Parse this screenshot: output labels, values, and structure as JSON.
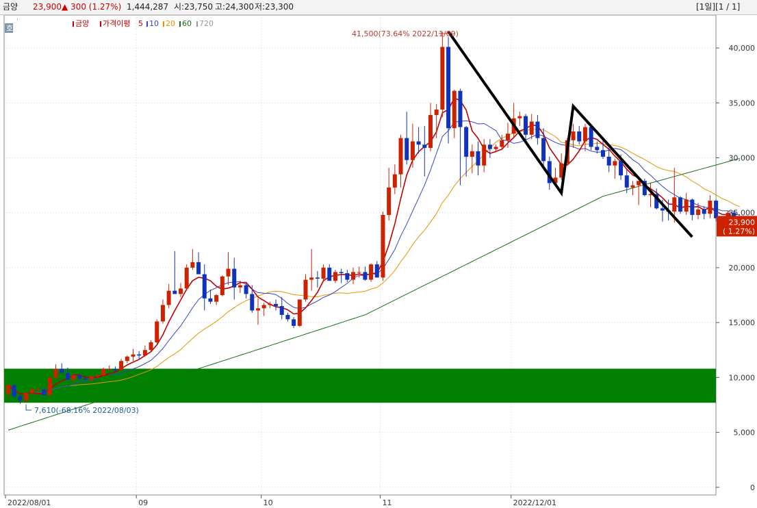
{
  "header": {
    "name": "금양",
    "price": "23,900",
    "change": "▲ 300 (1.27%)",
    "volume": "1,444,287",
    "open": "시:23,750",
    "high": "고:24,300",
    "low": "저:23,300",
    "paging": "[1일][1 / 1]"
  },
  "legend": {
    "name": "금양",
    "ma_label": "가격이평",
    "periods": [
      {
        "label": "5",
        "color": "#c00000"
      },
      {
        "label": "10",
        "color": "#3344cc"
      },
      {
        "label": "20",
        "color": "#e69500"
      },
      {
        "label": "60",
        "color": "#157015"
      },
      {
        "label": "720",
        "color": "#999999"
      }
    ],
    "corner_tag": "호"
  },
  "price_box": {
    "price": "23,900",
    "change": "( 1.27%)"
  },
  "annotations": {
    "high": "41,500(73.64% 2022/11/09)",
    "low": "7,610(-68.16% 2022/08/03)"
  },
  "colors": {
    "up": "#cc2200",
    "down": "#1133bb",
    "band": "#007f00",
    "drawn_line": "#000000"
  },
  "chart_data": {
    "type": "candlestick",
    "y_ticks": [
      "0",
      "5,000",
      "10,000",
      "15,000",
      "20,000",
      "25,000",
      "30,000",
      "35,000",
      "40,000"
    ],
    "ylim": [
      -700,
      43000
    ],
    "x_labels": [
      {
        "i": 0,
        "label": "2022/08/01"
      },
      {
        "i": 22,
        "label": "09"
      },
      {
        "i": 43,
        "label": "10"
      },
      {
        "i": 63,
        "label": "11"
      },
      {
        "i": 85,
        "label": "2022/12/01"
      }
    ],
    "ohlc": [
      [
        8500,
        9500,
        8100,
        9300
      ],
      [
        9300,
        9400,
        8100,
        8300
      ],
      [
        8300,
        8500,
        7610,
        7900
      ],
      [
        7900,
        8700,
        7700,
        8600
      ],
      [
        8600,
        9100,
        8400,
        8900
      ],
      [
        8900,
        9100,
        8600,
        8900
      ],
      [
        8900,
        9100,
        8300,
        8400
      ],
      [
        8400,
        10100,
        8300,
        10000
      ],
      [
        10000,
        11200,
        9800,
        10800
      ],
      [
        10800,
        11300,
        10400,
        10400
      ],
      [
        10400,
        10900,
        9800,
        9800
      ],
      [
        9800,
        10400,
        9500,
        10200
      ],
      [
        10200,
        10400,
        9800,
        9900
      ],
      [
        9900,
        10200,
        9700,
        9800
      ],
      [
        9800,
        10200,
        9600,
        10100
      ],
      [
        10100,
        10400,
        9900,
        10200
      ],
      [
        10200,
        10900,
        10100,
        10800
      ],
      [
        10800,
        11100,
        10600,
        10800
      ],
      [
        10800,
        11000,
        10400,
        10700
      ],
      [
        10700,
        11700,
        10600,
        11500
      ],
      [
        11500,
        12000,
        11300,
        11900
      ],
      [
        11900,
        12600,
        11500,
        12100
      ],
      [
        12100,
        12400,
        11700,
        12000
      ],
      [
        12000,
        12900,
        11900,
        12500
      ],
      [
        12500,
        13400,
        12400,
        13200
      ],
      [
        13200,
        15300,
        13100,
        15100
      ],
      [
        15100,
        17100,
        14900,
        16600
      ],
      [
        16600,
        18500,
        16300,
        17900
      ],
      [
        17900,
        21500,
        17700,
        17600
      ],
      [
        17600,
        18600,
        17300,
        18100
      ],
      [
        18100,
        20300,
        17900,
        20000
      ],
      [
        20000,
        21700,
        19800,
        20500
      ],
      [
        20500,
        21400,
        19900,
        19400
      ],
      [
        19400,
        20300,
        16100,
        17200
      ],
      [
        17200,
        18000,
        16700,
        16900
      ],
      [
        16900,
        17600,
        16600,
        17500
      ],
      [
        17500,
        19300,
        17400,
        19200
      ],
      [
        19200,
        21400,
        18400,
        19900
      ],
      [
        19900,
        20900,
        17100,
        18200
      ],
      [
        18200,
        18800,
        17700,
        18400
      ],
      [
        18400,
        18600,
        17200,
        17600
      ],
      [
        17600,
        18400,
        15900,
        16100
      ],
      [
        16100,
        17200,
        14800,
        16300
      ],
      [
        16300,
        16800,
        15600,
        16600
      ],
      [
        16600,
        16900,
        16300,
        16700
      ],
      [
        16700,
        17100,
        16100,
        16500
      ],
      [
        16500,
        17300,
        15300,
        15700
      ],
      [
        15700,
        15900,
        15100,
        15300
      ],
      [
        15300,
        15500,
        14500,
        14700
      ],
      [
        14700,
        17100,
        14600,
        17100
      ],
      [
        17100,
        19400,
        16900,
        18900
      ],
      [
        18900,
        21700,
        17900,
        19100
      ],
      [
        19100,
        19700,
        18200,
        19000
      ],
      [
        19000,
        20300,
        18700,
        20000
      ],
      [
        20000,
        20300,
        18800,
        18800
      ],
      [
        18800,
        19800,
        18600,
        19600
      ],
      [
        19600,
        19900,
        18600,
        19500
      ],
      [
        19500,
        19800,
        18700,
        18900
      ],
      [
        18900,
        20000,
        18500,
        19600
      ],
      [
        19600,
        20100,
        19100,
        19600
      ],
      [
        19600,
        20100,
        18800,
        18900
      ],
      [
        18900,
        20400,
        18700,
        20300
      ],
      [
        20300,
        20600,
        19500,
        19100
      ],
      [
        19100,
        25100,
        18800,
        24800
      ],
      [
        24800,
        29100,
        24300,
        27300
      ],
      [
        27300,
        29400,
        26700,
        28500
      ],
      [
        28500,
        32100,
        27300,
        31800
      ],
      [
        31800,
        34200,
        29400,
        29800
      ],
      [
        29800,
        33100,
        29100,
        31500
      ],
      [
        31500,
        32800,
        30400,
        31200
      ],
      [
        31200,
        32900,
        28300,
        30900
      ],
      [
        30900,
        35000,
        30600,
        33900
      ],
      [
        33900,
        34900,
        31800,
        34400
      ],
      [
        34400,
        41500,
        33700,
        40100
      ],
      [
        40100,
        41000,
        31300,
        32700
      ],
      [
        32700,
        36200,
        31800,
        36100
      ],
      [
        36100,
        36300,
        27500,
        32800
      ],
      [
        32800,
        32900,
        28300,
        30100
      ],
      [
        30100,
        31200,
        28600,
        30600
      ],
      [
        30600,
        31500,
        28400,
        29300
      ],
      [
        29300,
        31700,
        28700,
        31200
      ],
      [
        31200,
        31700,
        30000,
        30800
      ],
      [
        30800,
        31200,
        30500,
        31000
      ],
      [
        31000,
        32100,
        30700,
        31600
      ],
      [
        31600,
        33200,
        30900,
        32200
      ],
      [
        32200,
        35000,
        31800,
        33600
      ],
      [
        33600,
        34200,
        32900,
        33800
      ],
      [
        33800,
        34000,
        31300,
        32100
      ],
      [
        32100,
        34000,
        31700,
        33300
      ],
      [
        33300,
        33900,
        31200,
        31800
      ],
      [
        31800,
        32700,
        29300,
        29700
      ],
      [
        29700,
        30100,
        27100,
        27700
      ],
      [
        27700,
        29100,
        27400,
        28200
      ],
      [
        28200,
        30400,
        28000,
        29500
      ],
      [
        29500,
        31800,
        29300,
        31600
      ],
      [
        31600,
        33100,
        30900,
        32400
      ],
      [
        32400,
        32900,
        31200,
        31500
      ],
      [
        31500,
        33100,
        30600,
        32800
      ],
      [
        32800,
        32900,
        30700,
        31000
      ],
      [
        31000,
        31500,
        30400,
        30700
      ],
      [
        30700,
        31700,
        29900,
        30100
      ],
      [
        30100,
        30900,
        28700,
        29300
      ],
      [
        29300,
        29900,
        28100,
        29700
      ],
      [
        29700,
        30300,
        28000,
        28400
      ],
      [
        28400,
        28900,
        26800,
        27300
      ],
      [
        27300,
        27900,
        26600,
        27500
      ],
      [
        27500,
        27900,
        25700,
        27900
      ],
      [
        27900,
        28100,
        26500,
        26600
      ],
      [
        26600,
        27700,
        25500,
        26700
      ],
      [
        26700,
        27200,
        25300,
        25400
      ],
      [
        25400,
        26200,
        24200,
        25200
      ],
      [
        25200,
        26200,
        24300,
        25100
      ],
      [
        25100,
        29100,
        24100,
        26400
      ],
      [
        26400,
        26500,
        24900,
        25100
      ],
      [
        25100,
        26800,
        24800,
        26200
      ],
      [
        26200,
        26300,
        24300,
        24800
      ],
      [
        24800,
        25900,
        24400,
        25300
      ],
      [
        25300,
        25600,
        24400,
        24900
      ],
      [
        24900,
        26600,
        24500,
        26100
      ],
      [
        26100,
        26200,
        24200,
        24500
      ],
      [
        24500,
        24600,
        23000,
        23500
      ],
      [
        23500,
        25200,
        23400,
        25000
      ],
      [
        25000,
        25200,
        23600,
        23700
      ],
      [
        23700,
        24300,
        23300,
        23900
      ]
    ]
  }
}
